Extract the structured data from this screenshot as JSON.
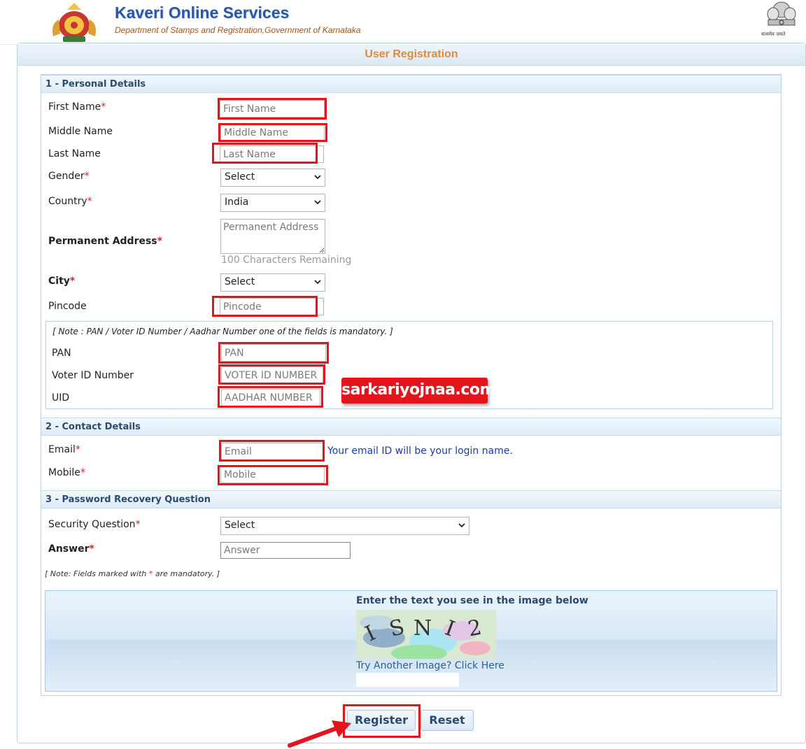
{
  "header": {
    "title": "Kaveri Online Services",
    "subtitle": "Department of Stamps and Registration,Government of Karnataka",
    "motto": "सत्यमेव जयते"
  },
  "form": {
    "title": "User Registration",
    "required_marker": "*",
    "sections": {
      "personal": "1 - Personal Details",
      "contact": "2 - Contact Details",
      "recovery": "3 - Password Recovery Question"
    },
    "fields": {
      "first_name": {
        "label": "First Name",
        "placeholder": "First Name"
      },
      "middle_name": {
        "label": "Middle Name",
        "placeholder": "Middle Name"
      },
      "last_name": {
        "label": "Last Name",
        "placeholder": "Last Name"
      },
      "gender": {
        "label": "Gender",
        "selected": "Select"
      },
      "country": {
        "label": "Country",
        "selected": "India"
      },
      "address": {
        "label": "Permanent Address",
        "placeholder": "Permanent Address",
        "remaining": "100 Characters Remaining"
      },
      "city": {
        "label": "City",
        "selected": "Select"
      },
      "pincode": {
        "label": "Pincode",
        "placeholder": "Pincode"
      },
      "pan": {
        "label": "PAN",
        "placeholder": "PAN"
      },
      "voter_id": {
        "label": "Voter ID Number",
        "placeholder": "VOTER ID NUMBER"
      },
      "uid": {
        "label": "UID",
        "placeholder": "AADHAR NUMBER"
      },
      "email": {
        "label": "Email",
        "placeholder": "Email",
        "hint": "Your email ID will be your login name."
      },
      "mobile": {
        "label": "Mobile",
        "placeholder": "Mobile"
      },
      "security_question": {
        "label": "Security Question",
        "selected": "Select"
      },
      "answer": {
        "label": "Answer",
        "placeholder": "Answer"
      }
    },
    "id_note": "[ Note : PAN / Voter ID Number / Aadhar Number one of the fields is mandatory. ]",
    "mandatory_note_prefix": "[ Note: Fields marked with ",
    "mandatory_note_suffix": " are mandatory. ]",
    "captcha": {
      "heading": "Enter the text you see in the image below",
      "text": "I S N I 2",
      "refresh_link": "Try Another Image? Click Here"
    },
    "buttons": {
      "register": "Register",
      "reset": "Reset"
    }
  },
  "watermark": "sarkariyojnaa.com",
  "colors": {
    "highlight": "#e3141b",
    "title_blue": "#2a56a8",
    "title_orange": "#e08a3c"
  }
}
